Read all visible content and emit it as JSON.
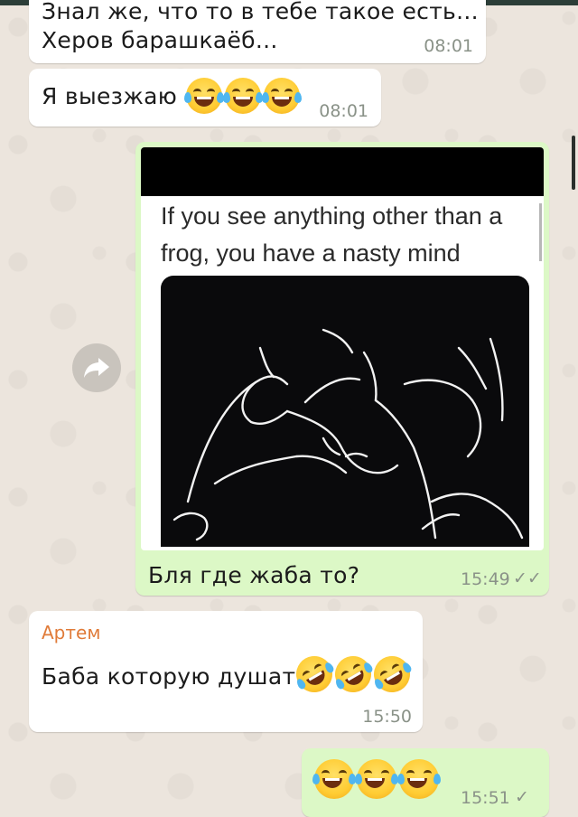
{
  "messages": {
    "m1": {
      "line1": "Знал же, что то в тебе такое есть...",
      "line2": "Херов барашкаёб...",
      "time": "08:01"
    },
    "m2": {
      "text": "Я выезжаю",
      "time": "08:01",
      "emojis": [
        "tears-of-joy-emoji",
        "tears-of-joy-emoji",
        "tears-of-joy-emoji"
      ]
    },
    "m3": {
      "image_caption_line1": "If you see anything other than a",
      "image_caption_line2": "frog, you have a nasty mind",
      "text": "Бля где жаба то?",
      "time": "15:49",
      "status": "✓✓"
    },
    "m4": {
      "sender": "Артем",
      "text": "Баба которую душат",
      "time": "15:50",
      "emojis": [
        "rofl-emoji",
        "rofl-emoji",
        "rofl-emoji"
      ]
    },
    "m5": {
      "time": "15:51",
      "status": "✓",
      "emojis": [
        "tears-of-joy-emoji",
        "tears-of-joy-emoji",
        "tears-of-joy-emoji"
      ]
    }
  },
  "icons": {
    "forward": "forward-arrow-icon"
  },
  "colors": {
    "incoming": "#ffffff",
    "outgoing": "#dcf8c6",
    "sender_name": "#e07b39",
    "background": "#ece5dd"
  }
}
